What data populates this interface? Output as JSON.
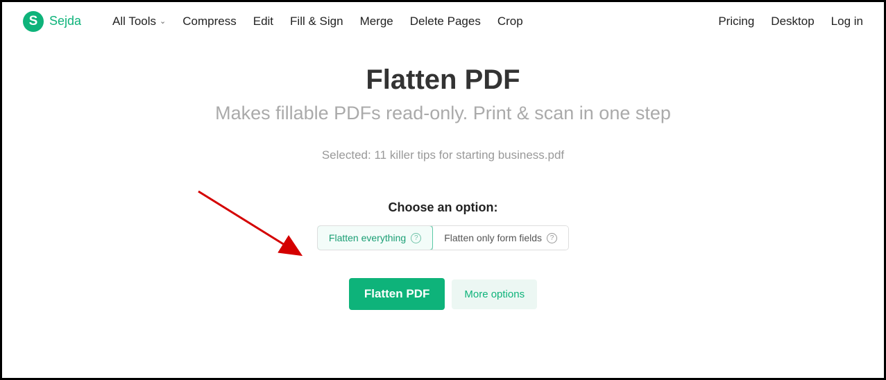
{
  "brand": {
    "logo_letter": "S",
    "name": "Sejda"
  },
  "nav": {
    "all_tools": "All Tools",
    "compress": "Compress",
    "edit": "Edit",
    "fill_sign": "Fill & Sign",
    "merge": "Merge",
    "delete_pages": "Delete Pages",
    "crop": "Crop",
    "pricing": "Pricing",
    "desktop": "Desktop",
    "login": "Log in"
  },
  "page": {
    "title": "Flatten PDF",
    "subtitle": "Makes fillable PDFs read-only. Print & scan in one step",
    "selected_prefix": "Selected: ",
    "selected_file": "11 killer tips for starting business.pdf",
    "choose_label": "Choose an option:"
  },
  "options": {
    "flatten_everything": "Flatten everything",
    "flatten_form_fields": "Flatten only form fields"
  },
  "actions": {
    "primary": "Flatten PDF",
    "more": "More options"
  }
}
